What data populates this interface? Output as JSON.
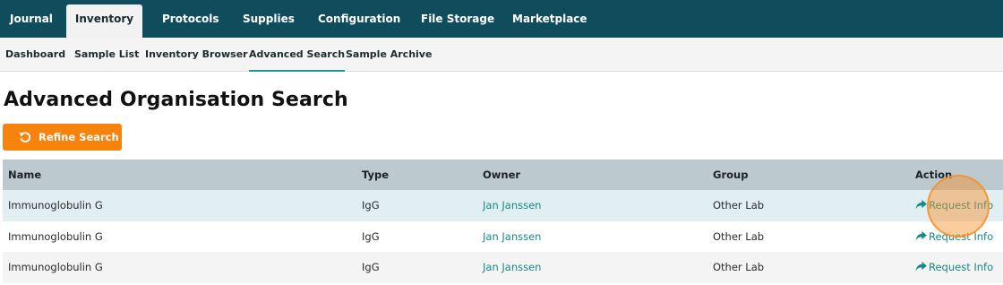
{
  "top_nav": {
    "tabs": [
      {
        "label": "Journal"
      },
      {
        "label": "Inventory",
        "active": true
      },
      {
        "label": "Protocols"
      },
      {
        "label": "Supplies"
      },
      {
        "label": "Configuration"
      },
      {
        "label": "File Storage"
      },
      {
        "label": "Marketplace"
      }
    ]
  },
  "sub_nav": {
    "items": [
      {
        "label": "Dashboard"
      },
      {
        "label": "Sample List"
      },
      {
        "label": "Inventory Browser"
      },
      {
        "label": "Advanced Search",
        "active": true
      },
      {
        "label": "Sample Archive"
      }
    ]
  },
  "page": {
    "title": "Advanced Organisation Search",
    "refine_button": {
      "label": "Refine Search",
      "icon": "refresh-icon"
    }
  },
  "table": {
    "columns": [
      "Name",
      "Type",
      "Owner",
      "Group",
      "Action"
    ],
    "rows": [
      {
        "name": "Immunoglobulin G",
        "type": "IgG",
        "owner": "Jan Janssen",
        "group": "Other Lab",
        "action": "Request Info"
      },
      {
        "name": "Immunoglobulin G",
        "type": "IgG",
        "owner": "Jan Janssen",
        "group": "Other Lab",
        "action": "Request Info"
      },
      {
        "name": "Immunoglobulin G",
        "type": "IgG",
        "owner": "Jan Janssen",
        "group": "Other Lab",
        "action": "Request Info"
      }
    ],
    "action_icon": "share-arrow-icon"
  },
  "colors": {
    "top_nav_bg": "#0f4c5c",
    "accent_teal": "#178a86",
    "button_orange": "#f7830c",
    "header_bg": "#bcc9cf",
    "highlight_row": "#e2eff2"
  }
}
